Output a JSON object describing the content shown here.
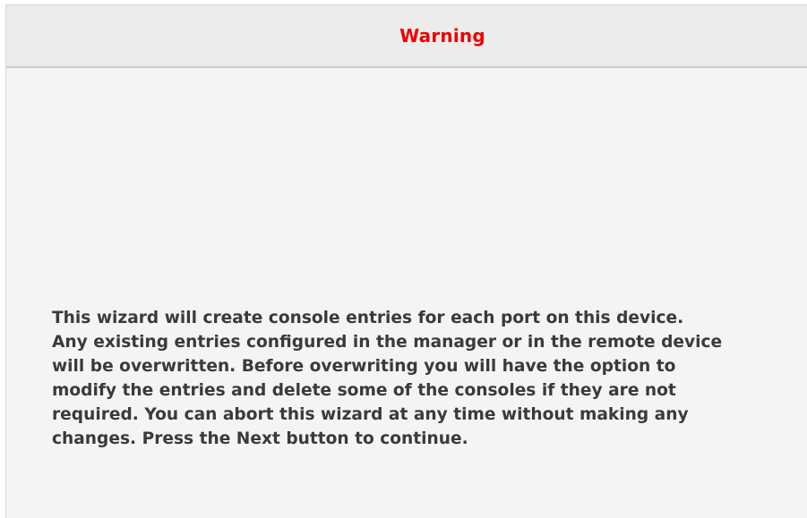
{
  "dialog": {
    "title": "Warning",
    "title_color": "#ee0000",
    "message_lines": [
      "This wizard will create console entries for each port on this device.",
      "Any existing entries configured in the manager or in the remote device",
      "will be overwritten. Before overwriting you will have the option to",
      "modify the entries and delete some of the consoles if they are not",
      "required. You can abort this wizard at any time without making any",
      "changes. Press the Next button to continue."
    ]
  }
}
